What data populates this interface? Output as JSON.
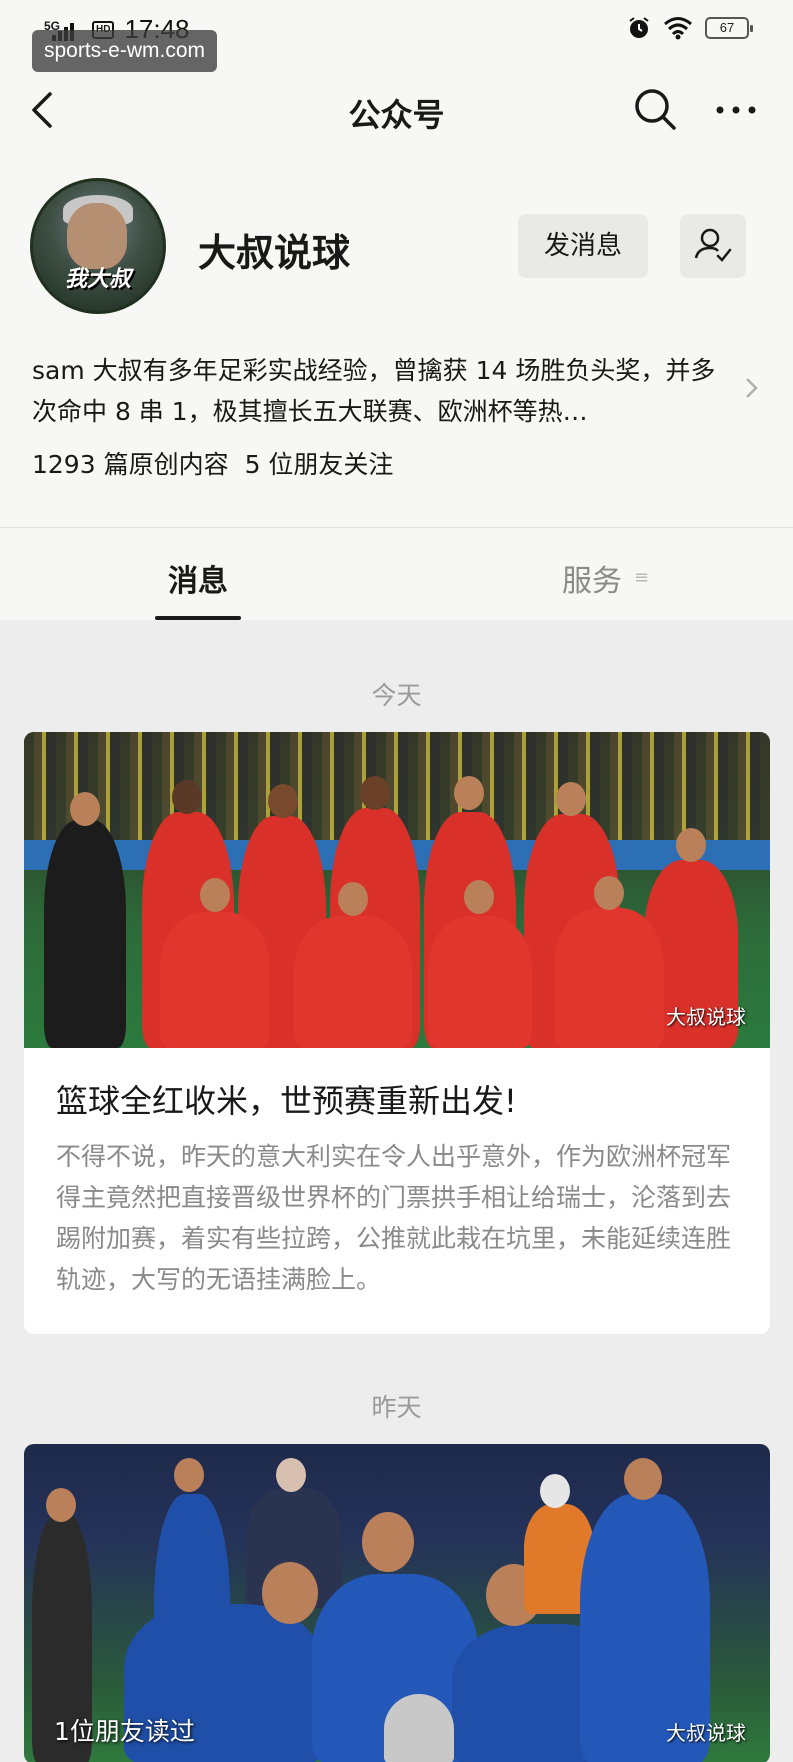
{
  "status_bar": {
    "network": "5G",
    "hd": "HD",
    "time": "17:48",
    "battery": "67"
  },
  "watermark": "sports-e-wm.com",
  "nav": {
    "title": "公众号"
  },
  "profile": {
    "avatar_text": "我大叔",
    "name": "大叔说球",
    "message_button": "发消息",
    "bio": "sam 大叔有多年足彩实战经验，曾擒获 14 场胜负头奖，并多次命中 8 串 1，极其擅长五大联赛、欧洲杯等热…",
    "original_count": "1293 篇原创内容",
    "friends_following": "5 位朋友关注"
  },
  "tabs": [
    {
      "label": "消息",
      "active": true
    },
    {
      "label": "服务",
      "active": false
    }
  ],
  "feed": [
    {
      "date": "今天",
      "image_watermark": "大叔说球",
      "title": "篮球全红收米，世预赛重新出发!",
      "summary": "不得不说，昨天的意大利实在令人出乎意外，作为欧洲杯冠军得主竟然把直接晋级世界杯的门票拱手相让给瑞士，沦落到去踢附加赛，着实有些拉跨，公推就此栽在坑里，未能延续连胜轨迹，大写的无语挂满脸上。"
    },
    {
      "date": "昨天",
      "image_watermark": "大叔说球",
      "read_badge": "1位朋友读过"
    }
  ],
  "colors": {
    "page_bg": "#ededed",
    "header_bg": "#f7f7f5",
    "belgium_red": "#d9302a",
    "italy_blue": "#1f4fa8"
  }
}
